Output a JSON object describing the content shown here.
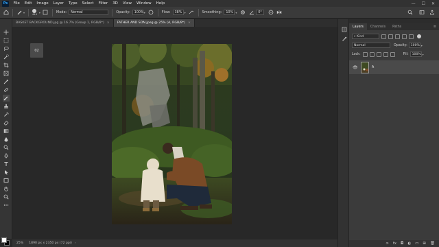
{
  "app": {
    "logo": "Ps",
    "menu": [
      "File",
      "Edit",
      "Image",
      "Layer",
      "Type",
      "Select",
      "Filter",
      "3D",
      "View",
      "Window",
      "Help"
    ],
    "window_controls": [
      "—",
      "☐",
      "✕"
    ]
  },
  "options_bar": {
    "brush_size": "444",
    "mode_label": "Mode:",
    "mode_value": "Normal",
    "opacity_label": "Opacity:",
    "opacity_value": "100%",
    "flow_label": "Flow:",
    "flow_value": "38%",
    "smoothing_label": "Smoothing:",
    "smoothing_value": "10%",
    "angle_value": "0°"
  },
  "tabs": [
    {
      "label": "BASKET BACKGROUND.jpg @ 16.7% (Group 1, RGB/8*)",
      "active": false
    },
    {
      "label": "FATHER AND SON.jpeg @ 25% (A, RGB/8*)",
      "active": true
    }
  ],
  "canvas": {
    "nav_chip_label": "02"
  },
  "status_bar": {
    "zoom": "25%",
    "doc_size": "1890 px x 2350 px (72 ppi)",
    "arrow": "›"
  },
  "layers_panel": {
    "tabs": [
      "Layers",
      "Channels",
      "Paths"
    ],
    "active_tab": "Layers",
    "filter_label": "Kind",
    "blend_mode": "Normal",
    "opacity_label": "Opacity:",
    "opacity_value": "100%",
    "lock_label": "Lock:",
    "fill_label": "Fill:",
    "fill_value": "100%",
    "layers": [
      {
        "name": "A",
        "visible": true
      }
    ],
    "bottom_icons": [
      "link-icon",
      "fx-icon",
      "mask-icon",
      "adjustment-icon",
      "group-icon",
      "new-layer-icon",
      "trash-icon"
    ]
  },
  "colors": {
    "foreground": "#ffffff",
    "background": "#000000",
    "accent": "#31a8ff"
  }
}
